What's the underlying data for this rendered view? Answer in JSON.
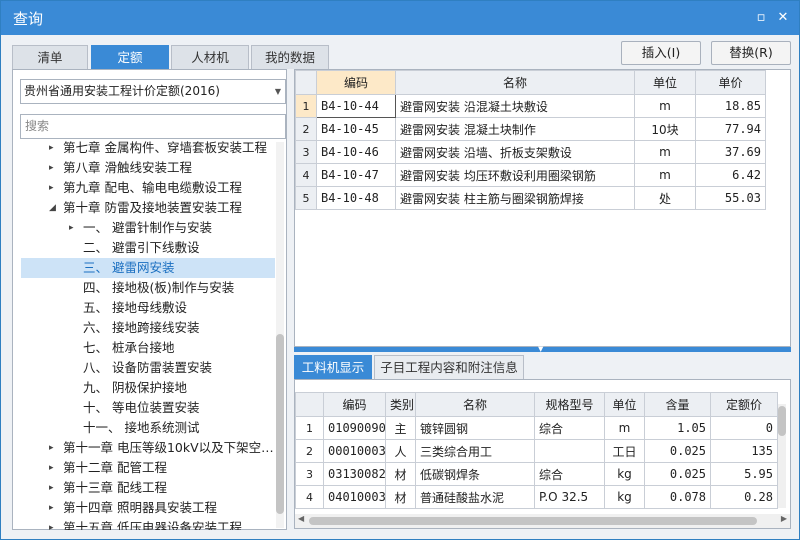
{
  "window": {
    "title": "查询",
    "minimize_glyph": "▫",
    "close_glyph": "✕"
  },
  "tabs": [
    {
      "label": "清单"
    },
    {
      "label": "定额"
    },
    {
      "label": "人材机"
    },
    {
      "label": "我的数据"
    }
  ],
  "actions": {
    "insert_label": "插入(I)",
    "replace_label": "替换(R)"
  },
  "left": {
    "library_value": "贵州省通用安装工程计价定额(2016)",
    "search_placeholder": "搜索",
    "tree": [
      {
        "label": "第七章 金属构件、穿墙套板安装工程",
        "toggle": "▸"
      },
      {
        "label": "第八章 滑触线安装工程",
        "toggle": "▸"
      },
      {
        "label": "第九章 配电、输电电缆敷设工程",
        "toggle": "▸"
      },
      {
        "label": "第十章 防雷及接地装置安装工程",
        "toggle": "◢"
      },
      {
        "label": "一、 避雷针制作与安装",
        "toggle": "▸"
      },
      {
        "label": "二、 避雷引下线敷设",
        "toggle": ""
      },
      {
        "label": "三、 避雷网安装",
        "toggle": ""
      },
      {
        "label": "四、 接地极(板)制作与安装",
        "toggle": ""
      },
      {
        "label": "五、 接地母线敷设",
        "toggle": ""
      },
      {
        "label": "六、 接地跨接线安装",
        "toggle": ""
      },
      {
        "label": "七、 桩承台接地",
        "toggle": ""
      },
      {
        "label": "八、 设备防雷装置安装",
        "toggle": ""
      },
      {
        "label": "九、 阴极保护接地",
        "toggle": ""
      },
      {
        "label": "十、 等电位装置安装",
        "toggle": ""
      },
      {
        "label": "十一、 接地系统测试",
        "toggle": ""
      },
      {
        "label": "第十一章 电压等级10kV以及下架空…",
        "toggle": "▸"
      },
      {
        "label": "第十二章 配管工程",
        "toggle": "▸"
      },
      {
        "label": "第十三章 配线工程",
        "toggle": "▸"
      },
      {
        "label": "第十四章 照明器具安装工程",
        "toggle": "▸"
      },
      {
        "label": "第十五章 低压电器设备安装工程",
        "toggle": "▸"
      }
    ]
  },
  "quota_table": {
    "headers": [
      "编码",
      "名称",
      "单位",
      "单价"
    ],
    "rows": [
      {
        "n": "1",
        "code": "B4-10-44",
        "name": "避雷网安装 沿混凝土块敷设",
        "unit": "m",
        "price": "18.85"
      },
      {
        "n": "2",
        "code": "B4-10-45",
        "name": "避雷网安装 混凝土块制作",
        "unit": "10块",
        "price": "77.94"
      },
      {
        "n": "3",
        "code": "B4-10-46",
        "name": "避雷网安装 沿墙、折板支架敷设",
        "unit": "m",
        "price": "37.69"
      },
      {
        "n": "4",
        "code": "B4-10-47",
        "name": "避雷网安装 均压环敷设利用圈梁钢筋",
        "unit": "m",
        "price": "6.42"
      },
      {
        "n": "5",
        "code": "B4-10-48",
        "name": "避雷网安装 柱主筋与圈梁钢筋焊接",
        "unit": "处",
        "price": "55.03"
      }
    ]
  },
  "bottom_tabs": [
    {
      "label": "工料机显示"
    },
    {
      "label": "子目工程内容和附注信息"
    }
  ],
  "material_table": {
    "headers": [
      "编码",
      "类别",
      "名称",
      "规格型号",
      "单位",
      "含量",
      "定额价"
    ],
    "rows": [
      {
        "n": "1",
        "code": "01090090",
        "type": "主",
        "name": "镀锌圆钢",
        "spec": "综合",
        "unit": "m",
        "qty": "1.05",
        "price": "0"
      },
      {
        "n": "2",
        "code": "00010003",
        "type": "人",
        "name": "三类综合用工",
        "spec": "",
        "unit": "工日",
        "qty": "0.025",
        "price": "135"
      },
      {
        "n": "3",
        "code": "03130082",
        "type": "材",
        "name": "低碳钢焊条",
        "spec": "综合",
        "unit": "kg",
        "qty": "0.025",
        "price": "5.95"
      },
      {
        "n": "4",
        "code": "04010003",
        "type": "材",
        "name": "普通硅酸盐水泥",
        "spec": "P.O 32.5",
        "unit": "kg",
        "qty": "0.078",
        "price": "0.28"
      }
    ]
  }
}
